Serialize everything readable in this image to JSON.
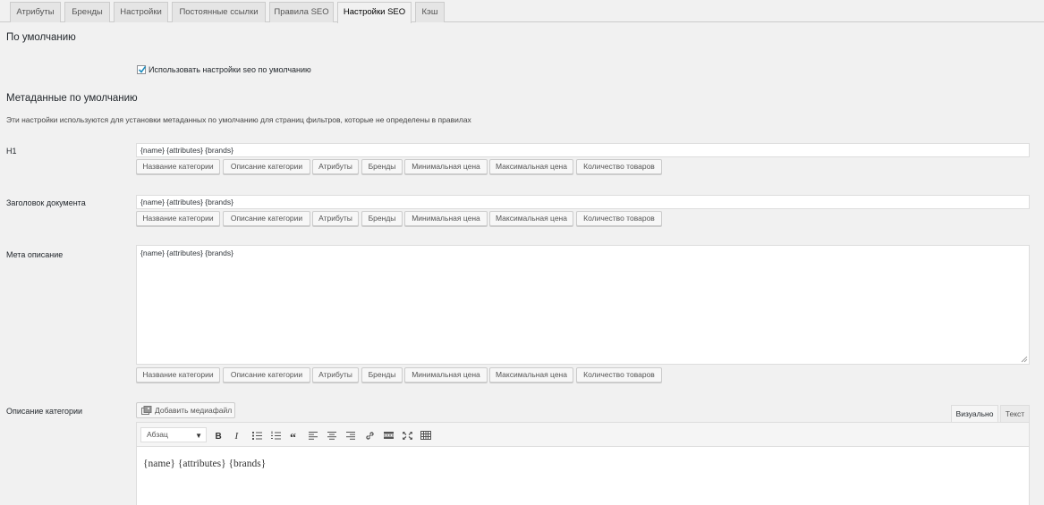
{
  "tabs": [
    "Атрибуты",
    "Бренды",
    "Настройки",
    "Постоянные ссылки",
    "Правила SEO",
    "Настройки SEO",
    "Кэш"
  ],
  "active_tab": "Настройки SEO",
  "section_default": {
    "title": "По умолчанию",
    "checkbox_label": "Использовать настройки seo по умолчанию",
    "checkbox_checked": true
  },
  "section_meta": {
    "title": "Метаданные по умолчанию",
    "description": "Эти настройки используются для установки метаданных по умолчанию для страниц фильтров, которые не определены в правилах"
  },
  "variable_buttons": [
    "Название категории",
    "Описание категории",
    "Атрибуты",
    "Бренды",
    "Минимальная цена",
    "Максимальная цена",
    "Количество товаров"
  ],
  "fields": {
    "h1": {
      "label": "H1",
      "value": "{name} {attributes} {brands}"
    },
    "doc_title": {
      "label": "Заголовок документа",
      "value": "{name} {attributes} {brands}"
    },
    "meta_desc": {
      "label": "Мета описание",
      "value": "{name} {attributes} {brands}"
    },
    "cat_desc": {
      "label": "Описание категории",
      "value": "{name} {attributes} {brands}"
    }
  },
  "editor": {
    "add_media": "Добавить медиафайл",
    "mode_visual": "Визуально",
    "mode_text": "Текст",
    "format_select": "Абзац",
    "toolbar_icons": [
      "bold-icon",
      "italic-icon",
      "bullet-list-icon",
      "numbered-list-icon",
      "blockquote-icon",
      "align-left-icon",
      "align-center-icon",
      "align-right-icon",
      "link-icon",
      "read-more-icon",
      "fullscreen-icon",
      "toolbar-toggle-icon"
    ]
  }
}
